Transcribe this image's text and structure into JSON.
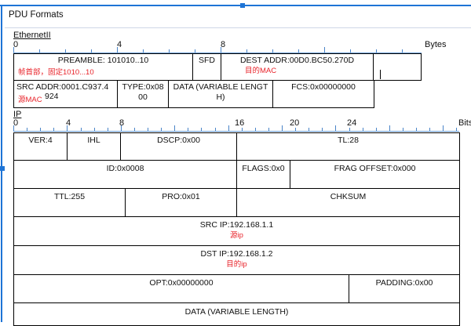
{
  "panel_title": "PDU Formats",
  "ethernet": {
    "label": "EthernetII",
    "units": "Bytes",
    "ruler": [
      "0",
      "4",
      "8"
    ],
    "preamble": "PREAMBLE: 101010..10",
    "preamble_note": "帧首部，固定1010...10",
    "sfd": "SFD",
    "dest": "DEST ADDR:00D0.BC50.270D",
    "dest_note": "目的MAC",
    "src_line1": "SRC ADDR:0001.C937.4",
    "src_line2": "924",
    "src_note": "源MAC",
    "type_line1": "TYPE:0x08",
    "type_line2": "00",
    "data_line1": "DATA (VARIABLE LENGT",
    "data_line2": "H)",
    "fcs": "FCS:0x00000000"
  },
  "ip": {
    "label": "IP",
    "units": "Bits",
    "ruler": [
      "0",
      "4",
      "8",
      "16",
      "20",
      "24"
    ],
    "ver": "VER:4",
    "ihl": "IHL",
    "dscp": "DSCP:0x00",
    "tl": "TL:28",
    "id": "ID:0x0008",
    "flags": "FLAGS:0x0",
    "frag": "FRAG OFFSET:0x000",
    "ttl": "TTL:255",
    "pro": "PRO:0x01",
    "chksum": "CHKSUM",
    "src_ip": "SRC IP:192.168.1.1",
    "src_ip_note": "源ip",
    "dst_ip": "DST IP:192.168.1.2",
    "dst_ip_note": "目的ip",
    "opt": "OPT:0x00000000",
    "padding": "PADDING:0x00",
    "data": "DATA (VARIABLE LENGTH)"
  }
}
